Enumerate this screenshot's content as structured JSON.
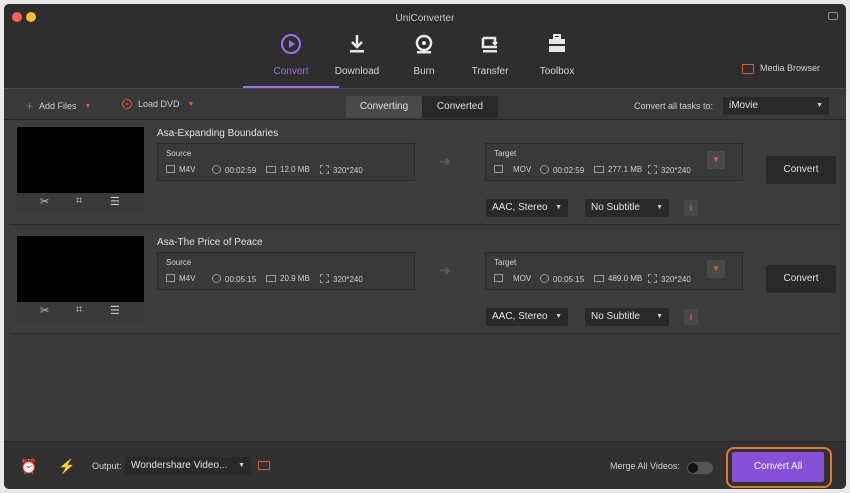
{
  "window": {
    "title": "UniConverter"
  },
  "nav": {
    "tabs": [
      {
        "label": "Convert",
        "icon": "convert-icon",
        "active": true
      },
      {
        "label": "Download",
        "icon": "download-icon"
      },
      {
        "label": "Burn",
        "icon": "burn-icon"
      },
      {
        "label": "Transfer",
        "icon": "transfer-icon"
      },
      {
        "label": "Toolbox",
        "icon": "toolbox-icon"
      }
    ],
    "media_browser": "Media Browser"
  },
  "toolbar": {
    "add_files": "Add Files",
    "load_dvd": "Load DVD",
    "segments": [
      "Converting",
      "Converted"
    ],
    "active_segment": "Converting",
    "convert_all_tasks_label": "Convert all tasks to:",
    "convert_all_tasks_value": "iMovie"
  },
  "tasks": [
    {
      "title": "Asa-Expanding Boundaries",
      "source": {
        "label": "Source",
        "format": "M4V",
        "duration": "00:02:59",
        "size": "12.0 MB",
        "resolution": "320*240"
      },
      "target": {
        "label": "Target",
        "format": "MOV",
        "duration": "00:02:59",
        "size": "277.1 MB",
        "resolution": "320*240"
      },
      "audio": "AAC, Stereo",
      "subtitle": "No Subtitle",
      "convert_label": "Convert"
    },
    {
      "title": "Asa-The Price of Peace",
      "source": {
        "label": "Source",
        "format": "M4V",
        "duration": "00:05:15",
        "size": "20.9 MB",
        "resolution": "320*240"
      },
      "target": {
        "label": "Target",
        "format": "MOV",
        "duration": "00:05:15",
        "size": "489.0 MB",
        "resolution": "320*240"
      },
      "audio": "AAC, Stereo",
      "subtitle": "No Subtitle",
      "convert_label": "Convert"
    }
  ],
  "bottom": {
    "output_label": "Output:",
    "output_value": "Wondershare Video...",
    "merge_label": "Merge All Videos:",
    "merge_on": false,
    "convert_all": "Convert All"
  },
  "colors": {
    "accent": "#9b6ff0",
    "convert_all_button": "#8650d8",
    "highlight_ring": "#e07b2b",
    "icon_red": "#e05a3a"
  }
}
